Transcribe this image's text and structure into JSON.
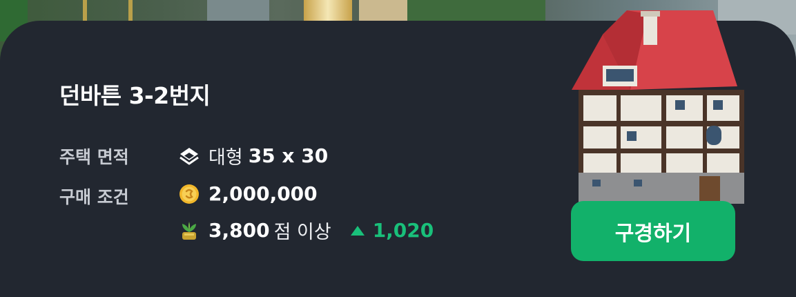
{
  "listing": {
    "title": "던바튼 3-2번지",
    "area_label": "주택 면적",
    "size_word": "대형",
    "size_value": "35 x 30",
    "purchase_label": "구매 조건",
    "price": "2,000,000",
    "score_value": "3,800",
    "score_suffix": "점 이상",
    "score_delta": "1,020"
  },
  "actions": {
    "view_label": "구경하기"
  },
  "colors": {
    "panel_bg": "#222730",
    "accent_green": "#12b16a",
    "delta_green": "#19c07a",
    "label_gray": "#c7cbd2"
  },
  "icons": {
    "size": "layers-icon",
    "price": "gold-coin-icon",
    "score": "trophy-plant-icon",
    "delta": "up-triangle-icon"
  }
}
